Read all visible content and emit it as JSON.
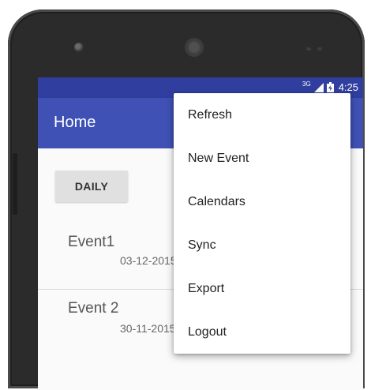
{
  "status_bar": {
    "network_type": "3G",
    "signal_icon": "signal-icon",
    "battery_icon": "battery-icon",
    "time": "4:25",
    "color": "#303f9f"
  },
  "app_bar": {
    "title": "Home",
    "color": "#3f51b5"
  },
  "content": {
    "daily_button_label": "DAILY",
    "events": [
      {
        "name": "Event1",
        "date": "03-12-2015"
      },
      {
        "name": "Event 2",
        "date": "30-11-2015"
      }
    ]
  },
  "overflow_menu": {
    "items": [
      {
        "label": "Refresh"
      },
      {
        "label": "New Event"
      },
      {
        "label": "Calendars"
      },
      {
        "label": "Sync"
      },
      {
        "label": "Export"
      },
      {
        "label": "Logout"
      }
    ]
  }
}
